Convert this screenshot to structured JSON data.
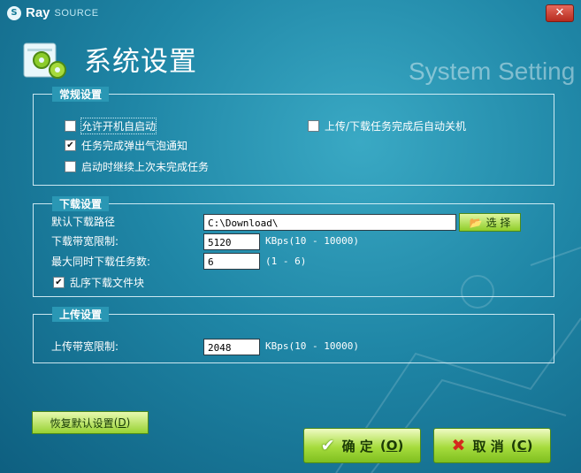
{
  "app": {
    "logo_ray": "Ray",
    "logo_source": "SOURCE",
    "close_symbol": "✕"
  },
  "header": {
    "title": "系统设置",
    "watermark": "System Setting"
  },
  "general": {
    "legend": "常规设置",
    "autostart": {
      "label": "允许开机自启动",
      "checked": false
    },
    "bubble_notify": {
      "label": "任务完成弹出气泡通知",
      "checked": true
    },
    "resume_tasks": {
      "label": "启动时继续上次未完成任务",
      "checked": false
    },
    "auto_shutdown": {
      "label": "上传/下载任务完成后自动关机",
      "checked": false
    }
  },
  "download": {
    "legend": "下载设置",
    "path_label": "默认下载路径",
    "path_value": "C:\\Download\\",
    "browse_label": "选 择",
    "bandwidth_label": "下载带宽限制:",
    "bandwidth_value": "5120",
    "bandwidth_hint": "KBps(10 - 10000)",
    "max_tasks_label": "最大同时下载任务数:",
    "max_tasks_value": "6",
    "max_tasks_hint": "(1 - 6)",
    "random_order": {
      "label": "乱序下载文件块",
      "checked": true
    }
  },
  "upload": {
    "legend": "上传设置",
    "bandwidth_label": "上传带宽限制:",
    "bandwidth_value": "2048",
    "bandwidth_hint": "KBps(10 - 10000)"
  },
  "buttons": {
    "reset_label": "恢复默认设置",
    "reset_key": "D",
    "ok_label": "确 定",
    "ok_key": "O",
    "cancel_label": "取 消",
    "cancel_key": "C"
  },
  "colors": {
    "accent_green": "#9ed63a",
    "background": "#1f86a6"
  }
}
